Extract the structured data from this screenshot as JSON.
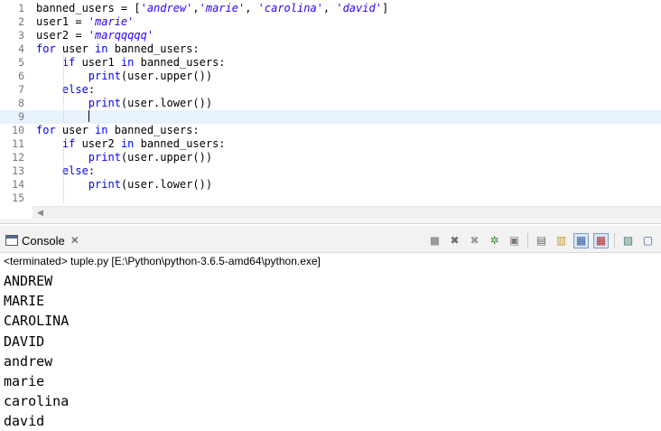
{
  "editor": {
    "lines": [
      {
        "num": "1",
        "tokens": [
          {
            "t": "banned_users = [",
            "c": ""
          },
          {
            "t": "'andrew'",
            "c": "str"
          },
          {
            "t": ",",
            "c": ""
          },
          {
            "t": "'marie'",
            "c": "str"
          },
          {
            "t": ", ",
            "c": ""
          },
          {
            "t": "'carolina'",
            "c": "str"
          },
          {
            "t": ", ",
            "c": ""
          },
          {
            "t": "'david'",
            "c": "str"
          },
          {
            "t": "]",
            "c": ""
          }
        ]
      },
      {
        "num": "2",
        "tokens": [
          {
            "t": "user1 = ",
            "c": ""
          },
          {
            "t": "'marie'",
            "c": "str"
          }
        ]
      },
      {
        "num": "3",
        "tokens": [
          {
            "t": "user2 = ",
            "c": ""
          },
          {
            "t": "'marqqqqq'",
            "c": "str"
          }
        ]
      },
      {
        "num": "4",
        "tokens": [
          {
            "t": "for",
            "c": "kw"
          },
          {
            "t": " user ",
            "c": ""
          },
          {
            "t": "in",
            "c": "kw"
          },
          {
            "t": " banned_users:",
            "c": ""
          }
        ]
      },
      {
        "num": "5",
        "tokens": [
          {
            "t": "    ",
            "c": ""
          },
          {
            "t": "if",
            "c": "kw"
          },
          {
            "t": " user1 ",
            "c": ""
          },
          {
            "t": "in",
            "c": "kw"
          },
          {
            "t": " banned_users:",
            "c": ""
          }
        ]
      },
      {
        "num": "6",
        "tokens": [
          {
            "t": "        ",
            "c": ""
          },
          {
            "t": "print",
            "c": "kw"
          },
          {
            "t": "(user.upper())",
            "c": ""
          }
        ]
      },
      {
        "num": "7",
        "tokens": [
          {
            "t": "    ",
            "c": ""
          },
          {
            "t": "else",
            "c": "kw"
          },
          {
            "t": ":",
            "c": ""
          }
        ]
      },
      {
        "num": "8",
        "tokens": [
          {
            "t": "        ",
            "c": ""
          },
          {
            "t": "print",
            "c": "kw"
          },
          {
            "t": "(user.lower())",
            "c": ""
          }
        ]
      },
      {
        "num": "9",
        "tokens": [
          {
            "t": "        ",
            "c": ""
          }
        ],
        "current": true
      },
      {
        "num": "10",
        "tokens": [
          {
            "t": "for",
            "c": "kw"
          },
          {
            "t": " user ",
            "c": ""
          },
          {
            "t": "in",
            "c": "kw"
          },
          {
            "t": " banned_users:",
            "c": ""
          }
        ]
      },
      {
        "num": "11",
        "tokens": [
          {
            "t": "    ",
            "c": ""
          },
          {
            "t": "if",
            "c": "kw"
          },
          {
            "t": " user2 ",
            "c": ""
          },
          {
            "t": "in",
            "c": "kw"
          },
          {
            "t": " banned_users:",
            "c": ""
          }
        ]
      },
      {
        "num": "12",
        "tokens": [
          {
            "t": "        ",
            "c": ""
          },
          {
            "t": "print",
            "c": "kw"
          },
          {
            "t": "(user.upper())",
            "c": ""
          }
        ]
      },
      {
        "num": "13",
        "tokens": [
          {
            "t": "    ",
            "c": ""
          },
          {
            "t": "else",
            "c": "kw"
          },
          {
            "t": ":",
            "c": ""
          }
        ]
      },
      {
        "num": "14",
        "tokens": [
          {
            "t": "        ",
            "c": ""
          },
          {
            "t": "print",
            "c": "kw"
          },
          {
            "t": "(user.lower())",
            "c": ""
          }
        ]
      },
      {
        "num": "15",
        "tokens": []
      }
    ],
    "colors": {
      "keyword": "#0000ff",
      "string": "#2a00ff",
      "current_line": "#e8f2fe",
      "line_number": "#787878"
    }
  },
  "console": {
    "tab_label": "Console",
    "tab_icon": "console-icon",
    "close_symbol": "✕",
    "status": "<terminated> tuple.py [E:\\Python\\python-3.6.5-amd64\\python.exe]",
    "output": [
      "ANDREW",
      "MARIE",
      "CAROLINA",
      "DAVID",
      "andrew",
      "marie",
      "carolina",
      "david"
    ],
    "toolbar": [
      {
        "name": "terminate-icon",
        "glyph": "■",
        "color": "#9a9a9a"
      },
      {
        "name": "remove-launch-icon",
        "glyph": "✖",
        "color": "#6e6e6e"
      },
      {
        "name": "remove-all-terminated-icon",
        "glyph": "✖",
        "color": "#9a9a9a"
      },
      {
        "name": "debug-icon",
        "glyph": "✲",
        "color": "#3a8a3a"
      },
      {
        "name": "restart-icon",
        "glyph": "▣",
        "color": "#7a7a7a"
      },
      {
        "name": "sep"
      },
      {
        "name": "clear-console-icon",
        "glyph": "▤",
        "color": "#6b6b6b"
      },
      {
        "name": "scroll-lock-icon",
        "glyph": "▥",
        "color": "#c79a2e"
      },
      {
        "name": "show-on-output-icon",
        "glyph": "▦",
        "color": "#3a5fa0",
        "pressed": true
      },
      {
        "name": "show-on-error-icon",
        "glyph": "▦",
        "color": "#b03030",
        "pressed": true
      },
      {
        "name": "sep"
      },
      {
        "name": "pin-console-icon",
        "glyph": "▧",
        "color": "#3a7a6a"
      },
      {
        "name": "display-console-icon",
        "glyph": "▢",
        "color": "#3a5fa0"
      }
    ]
  }
}
